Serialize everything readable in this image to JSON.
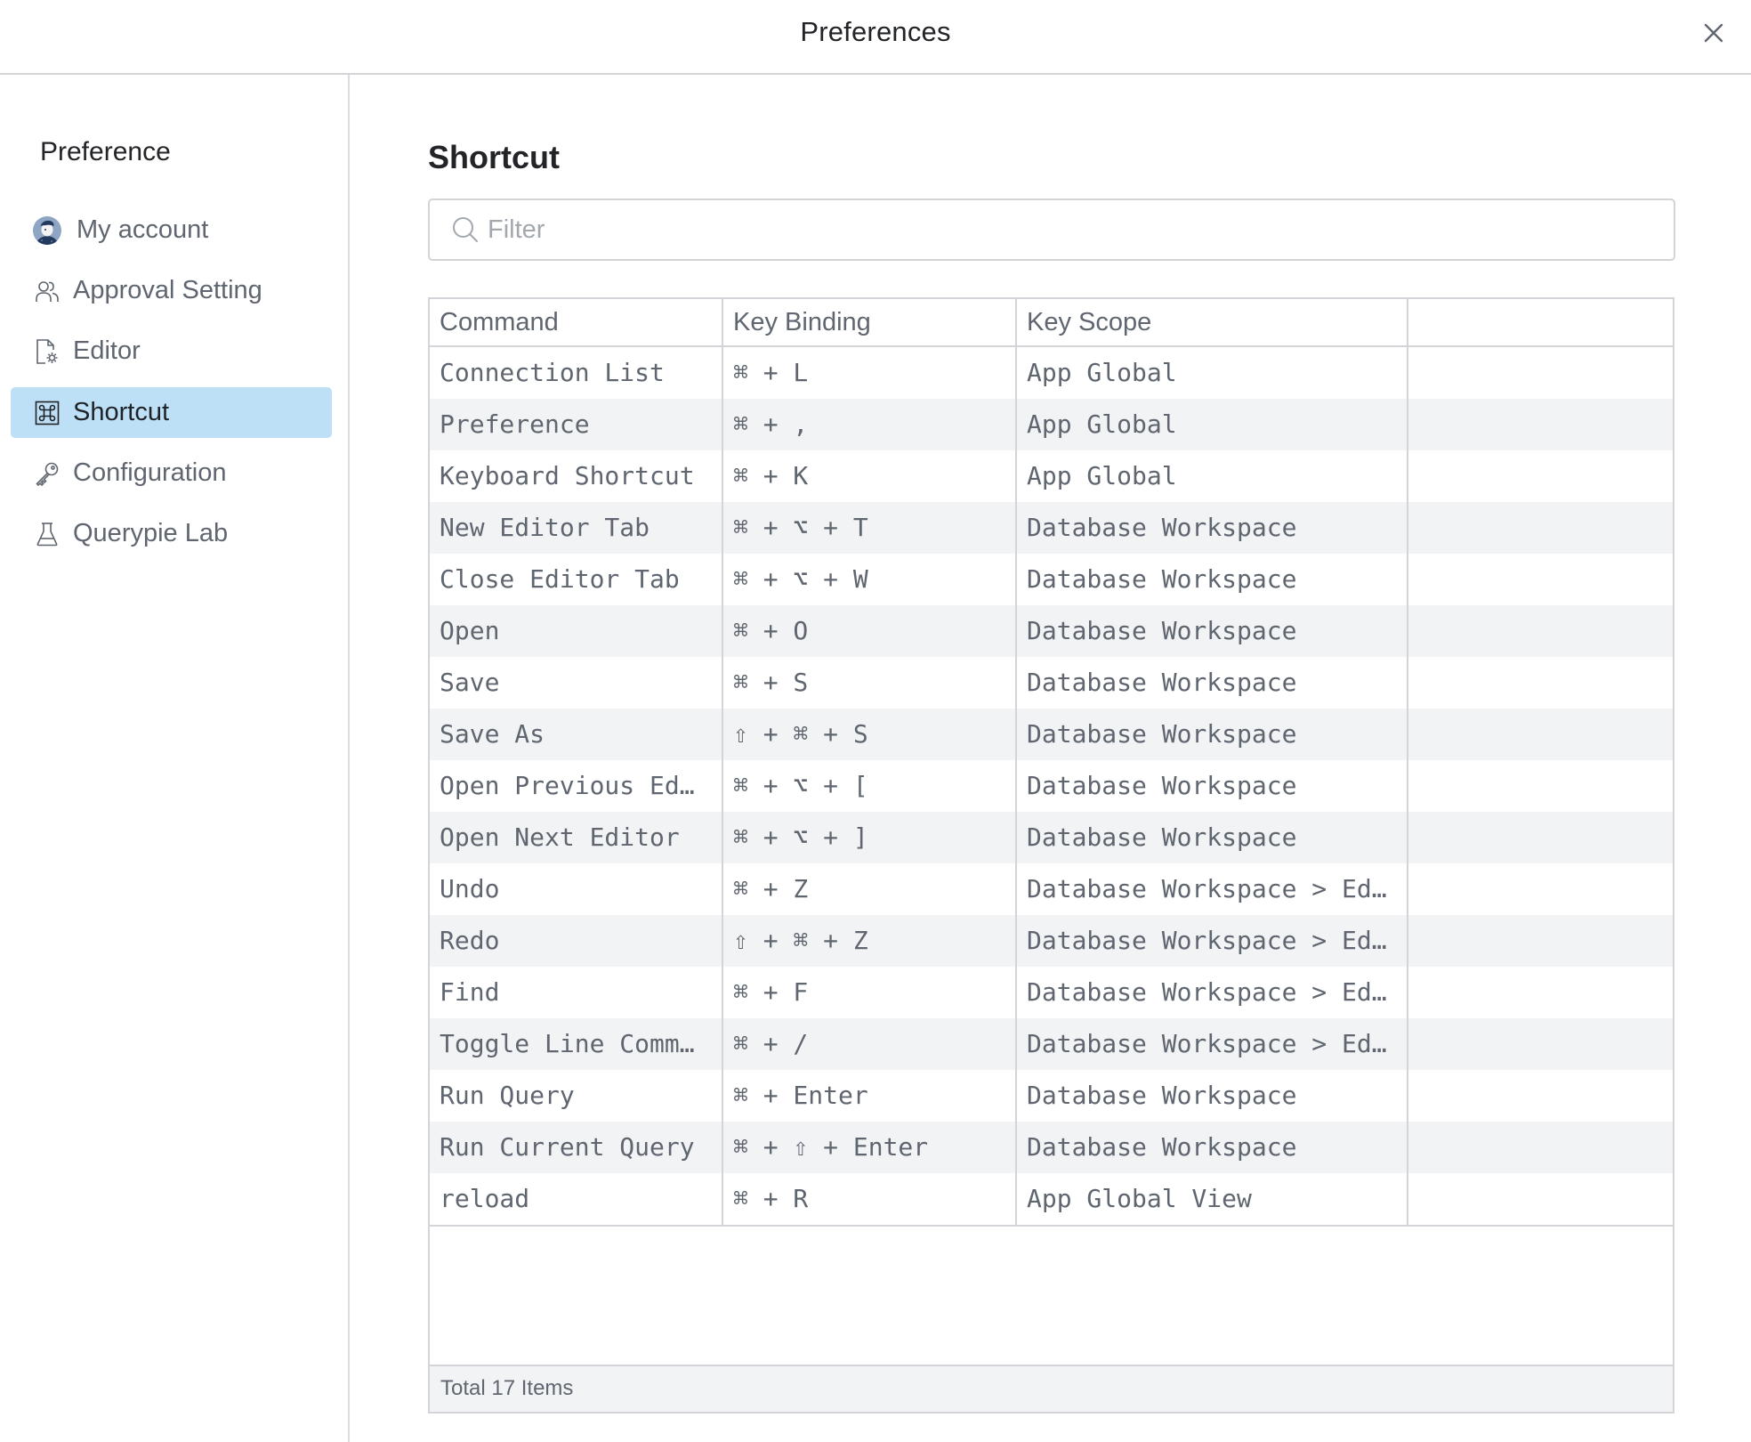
{
  "window": {
    "title": "Preferences",
    "close_icon": "close-icon"
  },
  "sidebar": {
    "title": "Preference",
    "items": [
      {
        "label": "My account",
        "icon": "avatar-icon",
        "active": false
      },
      {
        "label": "Approval Setting",
        "icon": "users-icon",
        "active": false
      },
      {
        "label": "Editor",
        "icon": "file-gear-icon",
        "active": false
      },
      {
        "label": "Shortcut",
        "icon": "command-key-icon",
        "active": true
      },
      {
        "label": "Configuration",
        "icon": "key-icon",
        "active": false
      },
      {
        "label": "Querypie Lab",
        "icon": "flask-icon",
        "active": false
      }
    ]
  },
  "main": {
    "title": "Shortcut",
    "filter": {
      "placeholder": "Filter",
      "value": "",
      "icon": "search-icon"
    },
    "table": {
      "columns": [
        "Command",
        "Key Binding",
        "Key Scope",
        ""
      ],
      "rows": [
        {
          "command": "Connection List",
          "binding": "⌘ + L",
          "scope": "App Global"
        },
        {
          "command": "Preference",
          "binding": "⌘ + ,",
          "scope": "App Global"
        },
        {
          "command": "Keyboard Shortcut",
          "binding": "⌘ + K",
          "scope": "App Global"
        },
        {
          "command": "New Editor Tab",
          "binding": "⌘ + ⌥ + T",
          "scope": "Database Workspace"
        },
        {
          "command": "Close Editor Tab",
          "binding": "⌘ + ⌥ + W",
          "scope": "Database Workspace"
        },
        {
          "command": "Open",
          "binding": "⌘ + O",
          "scope": "Database Workspace"
        },
        {
          "command": "Save",
          "binding": "⌘ + S",
          "scope": "Database Workspace"
        },
        {
          "command": "Save As",
          "binding": "⇧ + ⌘ + S",
          "scope": "Database Workspace"
        },
        {
          "command": "Open Previous Ed…",
          "binding": "⌘ + ⌥ + [",
          "scope": "Database Workspace"
        },
        {
          "command": "Open Next Editor",
          "binding": "⌘ + ⌥ + ]",
          "scope": "Database Workspace"
        },
        {
          "command": "Undo",
          "binding": "⌘ + Z",
          "scope": "Database Workspace > Ed…"
        },
        {
          "command": "Redo",
          "binding": "⇧ + ⌘ + Z",
          "scope": "Database Workspace > Ed…"
        },
        {
          "command": "Find",
          "binding": "⌘ + F",
          "scope": "Database Workspace > Ed…"
        },
        {
          "command": "Toggle Line Comm…",
          "binding": "⌘ + /",
          "scope": "Database Workspace > Ed…"
        },
        {
          "command": "Run Query",
          "binding": "⌘ + Enter",
          "scope": "Database Workspace"
        },
        {
          "command": "Run Current Query",
          "binding": "⌘ + ⇧ + Enter",
          "scope": "Database Workspace"
        },
        {
          "command": "reload",
          "binding": "⌘ + R",
          "scope": "App Global View"
        }
      ],
      "footer": "Total 17 Items"
    }
  },
  "colors": {
    "active_item_bg": "#bde0f7",
    "stripe_bg": "#f2f3f5",
    "border": "#d4d4d8",
    "text_muted": "#5f6670",
    "text_strong": "#222428"
  }
}
